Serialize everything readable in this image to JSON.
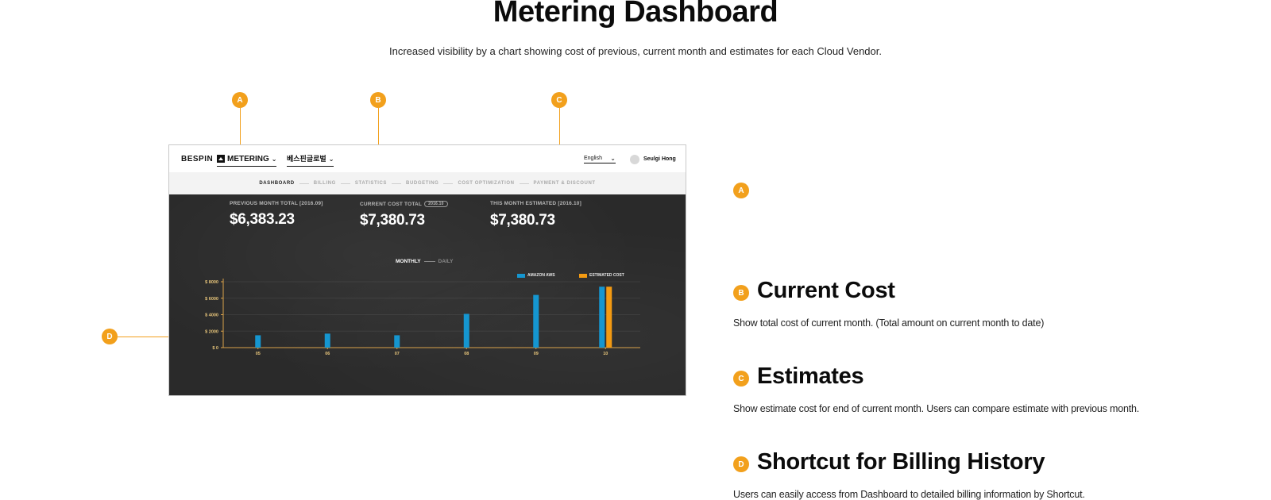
{
  "page": {
    "title": "Metering Dashboard",
    "subtitle": "Increased visibility by a chart showing cost of previous, current month and estimates for each Cloud Vendor."
  },
  "markers": {
    "a": "A",
    "b": "B",
    "c": "C",
    "d": "D"
  },
  "app": {
    "brand": "BESPIN",
    "product": "METERING",
    "org": "베스핀글로벌",
    "language": "English",
    "user": "Seulgi Hong",
    "nav": [
      "DASHBOARD",
      "BILLING",
      "STATISTICS",
      "BUDGETING",
      "COST OPTIMIZATION",
      "PAYMENT & DISCOUNT"
    ],
    "active_nav": "DASHBOARD",
    "stats": {
      "previous": {
        "label": "PREVIOUS MONTH TOTAL [2016.09]",
        "value": "$6,383.23"
      },
      "current": {
        "label": "CURRENT COST TOTAL",
        "tag": "2016.10",
        "value": "$7,380.73"
      },
      "estimated": {
        "label": "THIS MONTH ESTIMATED [2016.10]",
        "value": "$7,380.73"
      }
    },
    "toggle": {
      "monthly": "MONTHLY",
      "daily": "DAILY"
    },
    "legend": {
      "aws": "AMAZON AWS",
      "estimated": "ESTIMATED COST"
    },
    "colors": {
      "aws": "#1596d0",
      "estimated": "#f39a12",
      "accent": "#f2a01c"
    }
  },
  "chart_data": {
    "type": "bar",
    "categories": [
      "05",
      "06",
      "07",
      "08",
      "09",
      "10"
    ],
    "y_ticks": [
      "$ 0",
      "$ 2000",
      "$ 4000",
      "$ 6000",
      "$ 8000"
    ],
    "ylim": [
      0,
      8000
    ],
    "series": [
      {
        "name": "AMAZON AWS",
        "values": [
          1500,
          1700,
          1500,
          4100,
          6400,
          7400
        ]
      },
      {
        "name": "ESTIMATED COST",
        "values": [
          null,
          null,
          null,
          null,
          null,
          7400
        ]
      }
    ]
  },
  "features": {
    "current": {
      "marker": "B",
      "title": "Current Cost",
      "desc": "Show total cost of current month. (Total amount on current month to date)"
    },
    "estimates": {
      "marker": "C",
      "title": "Estimates",
      "desc": "Show estimate cost for end of current month. Users can compare estimate with previous month."
    },
    "shortcut": {
      "marker": "D",
      "title": "Shortcut for Billing History",
      "desc": "Users can easily access from Dashboard to detailed billing information by Shortcut."
    }
  }
}
